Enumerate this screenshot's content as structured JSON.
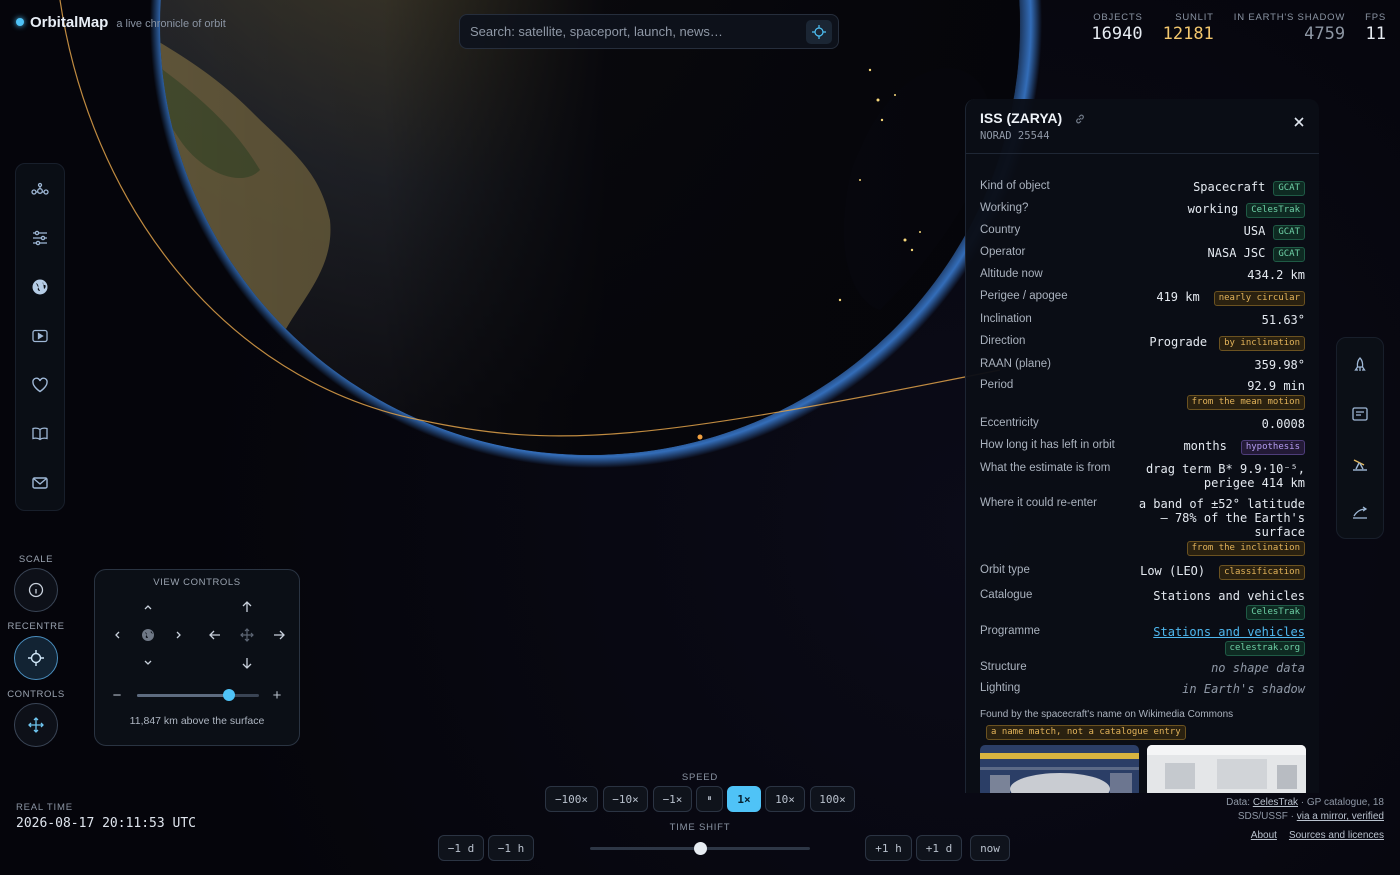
{
  "brand": {
    "name": "OrbitalMap",
    "tagline": "a live chronicle of orbit"
  },
  "search": {
    "placeholder": "Search: satellite, spaceport, launch, news…"
  },
  "stats": [
    {
      "label": "OBJECTS",
      "value": "16940"
    },
    {
      "label": "SUNLIT",
      "value": "12181"
    },
    {
      "label": "IN EARTH'S SHADOW",
      "value": "4759"
    },
    {
      "label": "FPS",
      "value": "11"
    }
  ],
  "left_rail": [
    "constellation-icon",
    "sliders-icon",
    "globe-icon",
    "play-video-icon",
    "heart-icon",
    "book-icon",
    "mail-icon"
  ],
  "right_rail": [
    "rocket-icon",
    "news-card-icon",
    "telescope-icon",
    "trajectory-icon"
  ],
  "controls": {
    "scale_label": "SCALE",
    "recentre_label": "RECENTRE",
    "controls_label": "CONTROLS"
  },
  "view_controls": {
    "title": "VIEW CONTROLS",
    "zoom_level": 0.75,
    "altitude_text": "11,847 km above the surface",
    "zoom_out": "−",
    "zoom_in": "+"
  },
  "real_time": {
    "label": "REAL TIME",
    "value": "2026-08-17 20:11:53 UTC"
  },
  "speed": {
    "label": "SPEED",
    "buttons": [
      "−100×",
      "−10×",
      "−1×",
      "⏸",
      "1×",
      "10×",
      "100×"
    ],
    "active": "1×"
  },
  "time_shift": {
    "label": "TIME SHIFT",
    "buttons_left": [
      "−1 d",
      "−1 h"
    ],
    "buttons_right": [
      "+1 h",
      "+1 d",
      "now"
    ],
    "position": 0.5
  },
  "footer": {
    "line1_prefix": "Data: ",
    "line1_link": "CelesTrak",
    "line1_suffix": " · GP catalogue, 18",
    "line2_prefix": "SDS/USSF · ",
    "line2_link": "via a mirror, verified",
    "about": "About",
    "sources": "Sources and licences"
  },
  "panel": {
    "title": "ISS (ZARYA)",
    "subtitle": "NORAD 25544",
    "rows": [
      {
        "label": "Kind of object",
        "value": "Spacecraft",
        "tag": "GCAT"
      },
      {
        "label": "Working?",
        "value": "working",
        "tag": "CelesTrak"
      },
      {
        "label": "Country",
        "value": "USA",
        "tag": "GCAT"
      },
      {
        "label": "Operator",
        "value": "NASA JSC",
        "tag": "GCAT"
      },
      {
        "label": "Altitude now",
        "value": "434.2 km"
      },
      {
        "label": "Perigee / apogee",
        "value": "419 km",
        "tag": "nearly circular"
      },
      {
        "label": "Inclination",
        "value": "51.63°"
      },
      {
        "label": "Direction",
        "value": "Prograde",
        "tag": "by inclination"
      },
      {
        "label": "RAAN (plane)",
        "value": "359.98°"
      },
      {
        "label": "Period",
        "value": "92.9 min",
        "tag": "from the mean motion"
      },
      {
        "label": "Eccentricity",
        "value": "0.0008"
      },
      {
        "label": "How long it has left in orbit",
        "value": "months",
        "tag": "hypothesis"
      },
      {
        "label": "What the estimate is from",
        "value_line1": "drag term B* 9.9·10⁻⁵,",
        "value_line2": "perigee 414 km"
      },
      {
        "label": "Where it could re-enter",
        "value_line1": "a band of ±52° latitude",
        "value_line2": "– 78% of the Earth's",
        "value_line3": "surface",
        "tag": "from the inclination"
      },
      {
        "label": "Orbit type",
        "value": "Low (LEO)",
        "tag": "classification"
      },
      {
        "label": "Catalogue",
        "value": "Stations and vehicles",
        "tag": "CelesTrak"
      },
      {
        "label": "Programme",
        "value": "Stations and vehicles",
        "tag": "celestrak.org"
      },
      {
        "label": "Structure",
        "value": "no shape data"
      },
      {
        "label": "Lighting",
        "value": "in Earth's shadow"
      }
    ],
    "found_text": "Found by the spacecraft's name on Wikimedia Commons",
    "found_tag": "a name match, not a catalogue entry"
  },
  "colors": {
    "accent": "#4fc3f7",
    "sunlit": "#f2c66d",
    "orbit": "#e0a24a",
    "atmosphere": "#3b7fd6"
  }
}
